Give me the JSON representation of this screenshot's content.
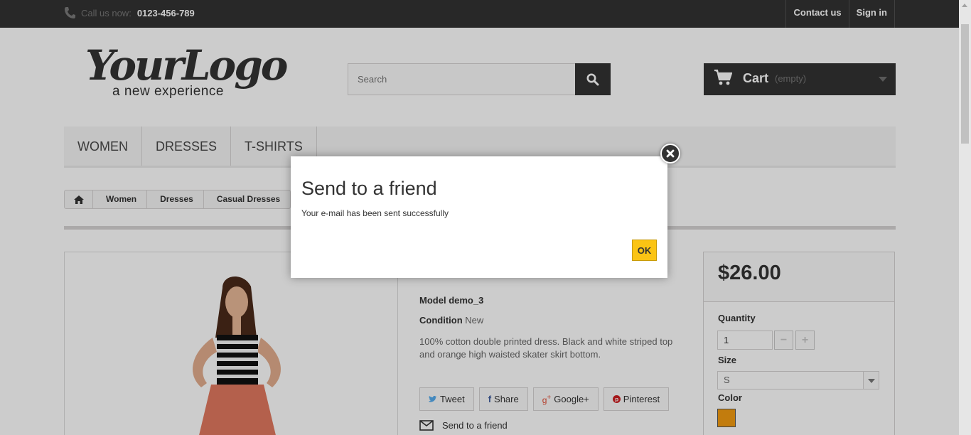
{
  "topbar": {
    "call_label": "Call us now:",
    "phone": "0123-456-789",
    "contact": "Contact us",
    "signin": "Sign in"
  },
  "logo": {
    "line1": "YourLogo",
    "line2": "a new experience"
  },
  "search": {
    "placeholder": "Search"
  },
  "cart": {
    "label": "Cart",
    "status": "(empty)"
  },
  "menu": {
    "items": [
      "WOMEN",
      "DRESSES",
      "T-SHIRTS"
    ]
  },
  "breadcrumb": {
    "items": [
      "Women",
      "Dresses",
      "Casual Dresses"
    ]
  },
  "product": {
    "model_label": "Model",
    "model": "demo_3",
    "condition_label": "Condition",
    "condition": "New",
    "description": "100% cotton double printed dress. Black and white striped top and orange high waisted skater skirt bottom."
  },
  "social": {
    "tweet": "Tweet",
    "share": "Share",
    "google": "Google+",
    "pinterest": "Pinterest"
  },
  "send_friend": "Send to a friend",
  "buy": {
    "price": "$26.00",
    "quantity_label": "Quantity",
    "quantity": "1",
    "minus": "−",
    "plus": "+",
    "size_label": "Size",
    "size": "S",
    "color_label": "Color",
    "color_value": "#f39c11"
  },
  "modal": {
    "title": "Send to a friend",
    "message": "Your e-mail has been sent successfully",
    "ok": "OK"
  },
  "colors": {
    "accent": "#fbc414",
    "dark": "#333333"
  }
}
